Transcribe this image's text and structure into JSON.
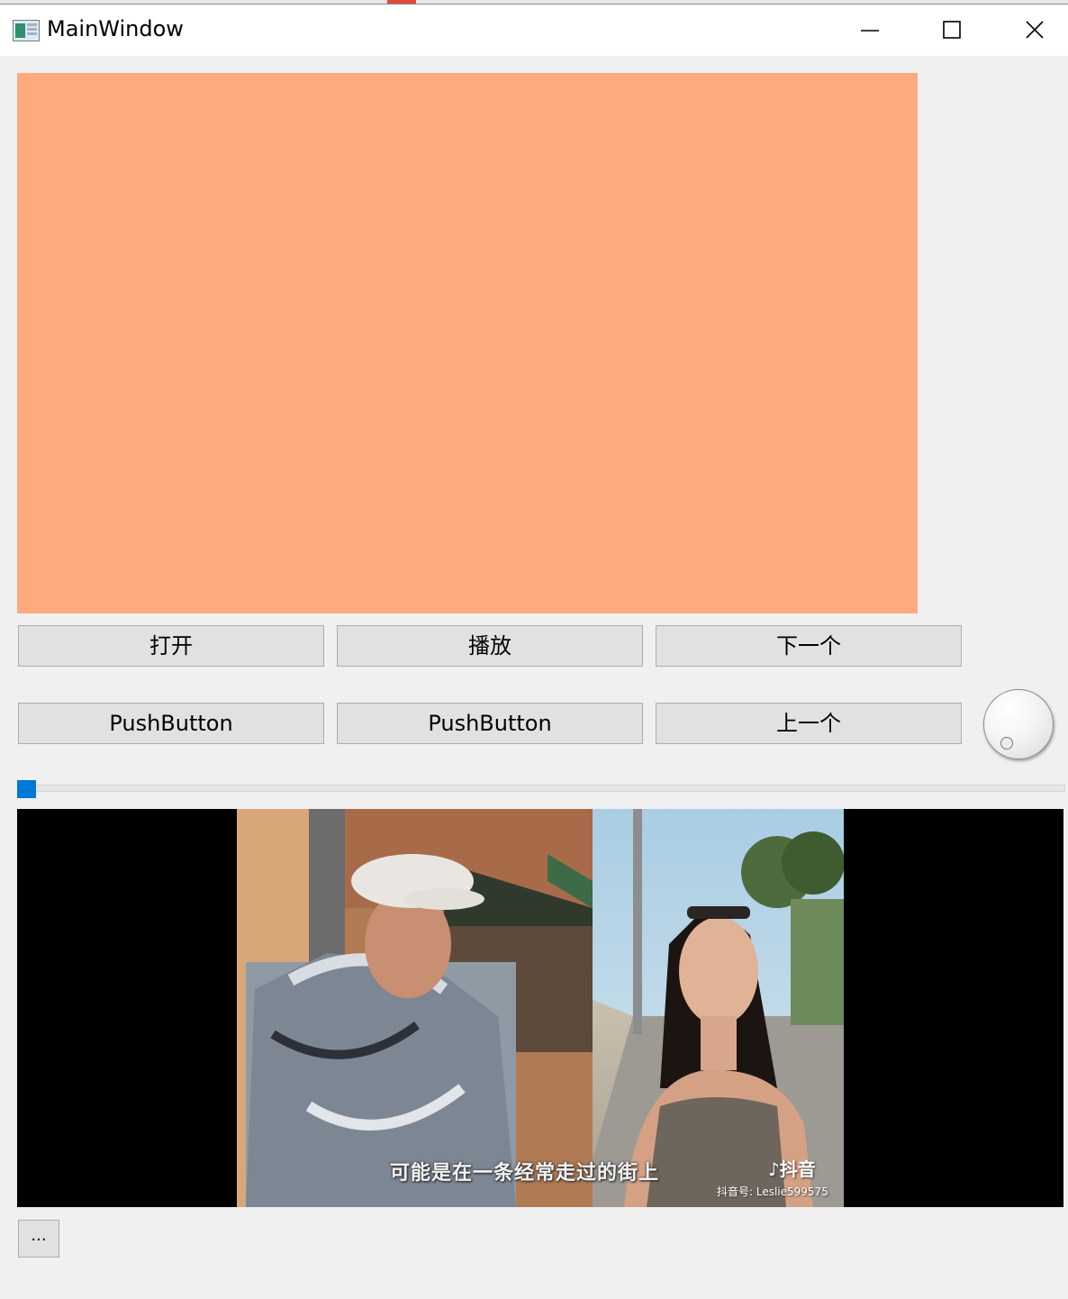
{
  "window": {
    "title": "MainWindow",
    "controls": {
      "minimize_icon": "minimize-icon",
      "maximize_icon": "maximize-icon",
      "close_icon": "close-icon"
    }
  },
  "colors": {
    "video_placeholder": "#ffaa7f",
    "slider_handle": "#0078d7",
    "player_background": "#000000"
  },
  "buttons": {
    "open": "打开",
    "play": "播放",
    "next": "下一个",
    "push1": "PushButton",
    "push2": "PushButton",
    "previous": "上一个",
    "more": "..."
  },
  "slider": {
    "position": 0
  },
  "player": {
    "subtitle": "可能是在一条经常走过的街上",
    "brand": "抖音",
    "account": "抖音号: Leslie599575"
  }
}
